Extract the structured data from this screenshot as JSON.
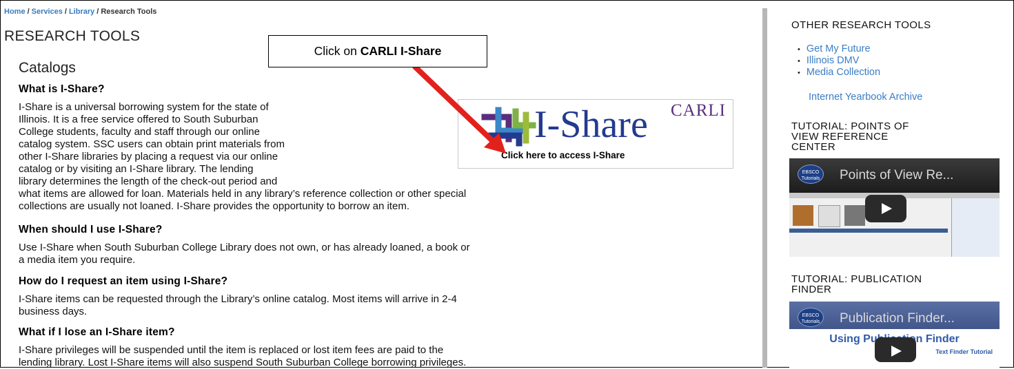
{
  "breadcrumb": {
    "home": "Home",
    "services": "Services",
    "library": "Library",
    "current": "Research Tools",
    "separator": "/"
  },
  "page_title": "RESEARCH TOOLS",
  "section_title": "Catalogs",
  "callout": {
    "prefix": "Click on ",
    "bold": "CARLI I-Share"
  },
  "ishare_banner": {
    "carli": "CARLI",
    "logo": "I-Share",
    "caption": "Click here to access I-Share"
  },
  "faq": [
    {
      "question": "What is I-Share?",
      "answer_lines": [
        "I-Share is a universal borrowing system for the state of",
        "Illinois. It is a free service offered to South Suburban",
        "College students, faculty and staff through our online",
        "catalog system. SSC users can obtain print materials from",
        "other I-Share libraries by placing a request via our online",
        "catalog or by visiting an I-Share library. The lending",
        "library determines the length of the check-out period and",
        "what items are allowed for loan. Materials held in any library’s reference collection or other special",
        "collections are usually not loaned. I-Share provides the opportunity to borrow an item."
      ]
    },
    {
      "question": "When should I use I-Share?",
      "answer_lines": [
        "Use I-Share when South Suburban College Library does not own, or has already loaned, a book or",
        "a media item you require."
      ]
    },
    {
      "question": "How do I request an item using I-Share?",
      "answer_lines": [
        "I-Share items can be requested through the Library’s online catalog. Most items will arrive in 2-4",
        "business days."
      ]
    },
    {
      "question": "What if I lose an I-Share item?",
      "answer_lines": [
        "I-Share privileges will be suspended until the item is replaced or lost item fees are paid to the",
        "lending library. Lost I-Share items will also suspend South Suburban College borrowing privileges."
      ]
    }
  ],
  "sidebar": {
    "other_tools_title": "OTHER RESEARCH TOOLS",
    "links": [
      "Get My Future",
      "Illinois DMV",
      "Media Collection"
    ],
    "yearbook_link": "Internet Yearbook Archive",
    "tutorial1_title_lines": [
      "TUTORIAL: POINTS OF",
      "VIEW REFERENCE",
      "CENTER"
    ],
    "tutorial1_video_title": "Points of View Re...",
    "tutorial2_title_lines": [
      "TUTORIAL: PUBLICATION",
      "FINDER"
    ],
    "tutorial2_video_title": "Publication Finder...",
    "tutorial2_video_heading": "Using Publication Finder",
    "tutorial2_video_sub": "Text Finder Tutorial",
    "ebsco_label": "EBSCO",
    "ebsco_sub": "Tutorials"
  },
  "colors": {
    "link": "#3b7dc4",
    "arrow": "#e3211c",
    "divider": "#b7b7b7",
    "carli_purple": "#5a2d7d",
    "ishare_blue": "#233a8f"
  }
}
